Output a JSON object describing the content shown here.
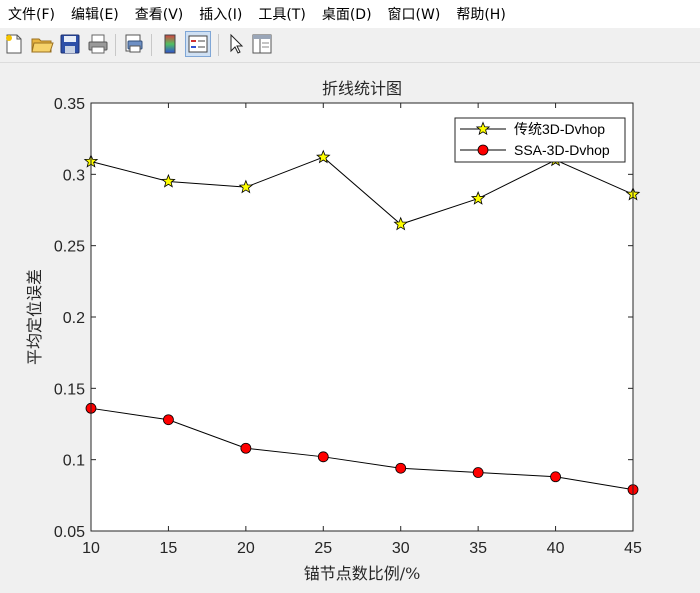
{
  "menubar": {
    "items": [
      "文件(F)",
      "编辑(E)",
      "查看(V)",
      "插入(I)",
      "工具(T)",
      "桌面(D)",
      "窗口(W)",
      "帮助(H)"
    ]
  },
  "toolbar": {
    "icons": [
      "new-file-icon",
      "open-folder-icon",
      "save-icon",
      "print-icon",
      "print-preview-icon",
      "colorbar-icon",
      "legend-icon",
      "pointer-icon",
      "property-editor-icon"
    ]
  },
  "chart_data": {
    "type": "line",
    "title": "折线统计图",
    "xlabel": "锚节点数比例/%",
    "ylabel": "平均定位误差",
    "x": [
      10,
      15,
      20,
      25,
      30,
      35,
      40,
      45
    ],
    "xlim": [
      10,
      45
    ],
    "ylim": [
      0.05,
      0.35
    ],
    "xticks": [
      "10",
      "15",
      "20",
      "25",
      "30",
      "35",
      "40",
      "45"
    ],
    "yticks": [
      "0.05",
      "0.1",
      "0.15",
      "0.2",
      "0.25",
      "0.3",
      "0.35"
    ],
    "grid": false,
    "legend_position": "top-right",
    "series": [
      {
        "name": "传统3D-Dvhop",
        "marker": "star",
        "color": "#ffff00",
        "values": [
          0.309,
          0.295,
          0.291,
          0.312,
          0.265,
          0.283,
          0.31,
          0.286
        ]
      },
      {
        "name": "SSA-3D-Dvhop",
        "marker": "circle",
        "color": "#ff0000",
        "values": [
          0.136,
          0.128,
          0.108,
          0.102,
          0.094,
          0.091,
          0.088,
          0.079
        ]
      }
    ]
  }
}
